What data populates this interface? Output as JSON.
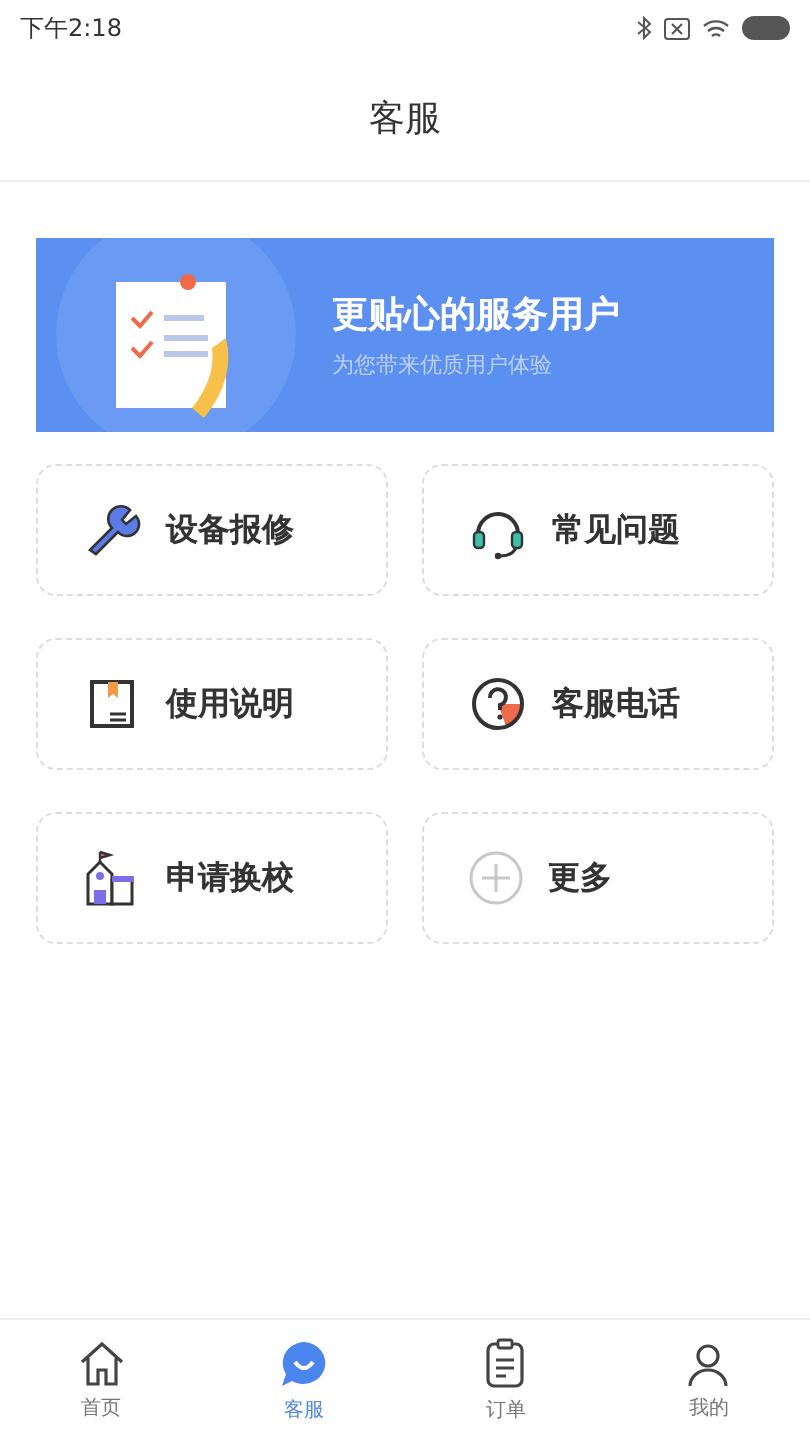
{
  "status_bar": {
    "time": "下午2:18"
  },
  "header": {
    "title": "客服"
  },
  "banner": {
    "headline": "更贴心的服务用户",
    "subtitle": "为您带来优质用户体验"
  },
  "tiles": [
    {
      "kind": "wrench",
      "label": "设备报修"
    },
    {
      "kind": "headset",
      "label": "常见问题"
    },
    {
      "kind": "manual",
      "label": "使用说明"
    },
    {
      "kind": "question",
      "label": "客服电话"
    },
    {
      "kind": "school",
      "label": "申请换校"
    },
    {
      "kind": "plus",
      "label": "更多"
    }
  ],
  "tab_bar": [
    {
      "kind": "home",
      "label": "首页",
      "selected": false
    },
    {
      "kind": "chat",
      "label": "客服",
      "selected": true
    },
    {
      "kind": "order",
      "label": "订单",
      "selected": false
    },
    {
      "kind": "user",
      "label": "我的",
      "selected": false
    }
  ]
}
